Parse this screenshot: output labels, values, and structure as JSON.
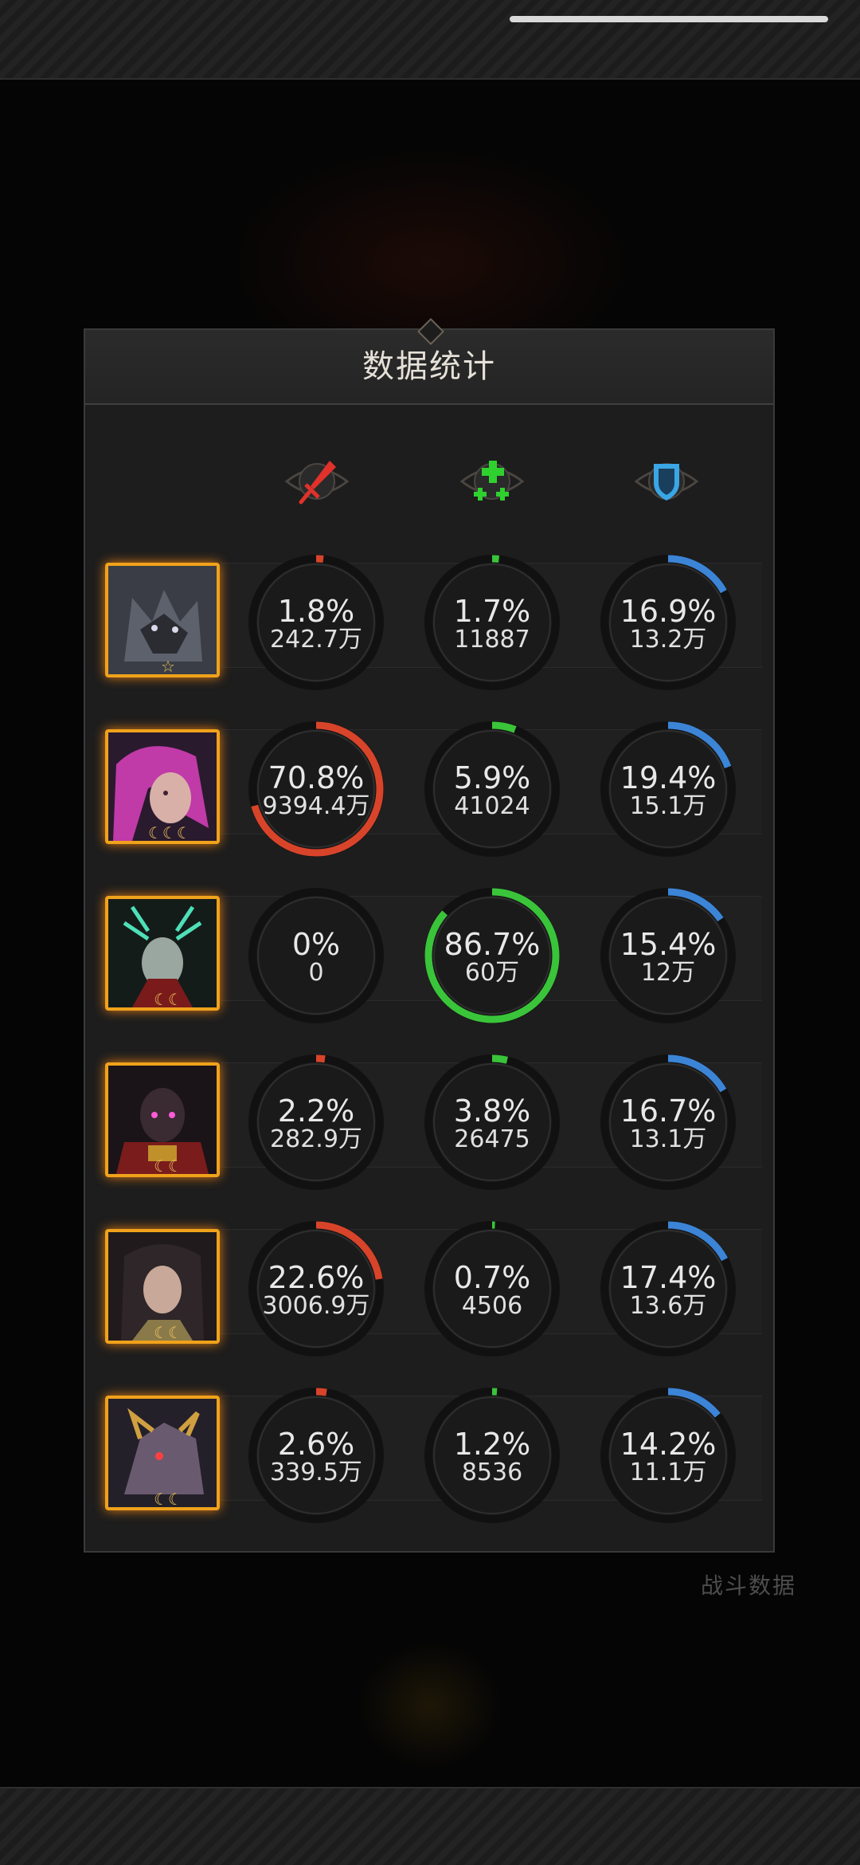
{
  "panel": {
    "title": "数据统计"
  },
  "background": {
    "caption": "战斗数据"
  },
  "columns": [
    {
      "icon": "sword-icon",
      "color": "#e0322a"
    },
    {
      "icon": "heal-cross-icon",
      "color": "#2fd12f"
    },
    {
      "icon": "shield-icon",
      "color": "#3aa6e6"
    }
  ],
  "colors": {
    "damage": "#d8442a",
    "heal": "#3ac43a",
    "tank": "#3c84d6",
    "avatar_border": "#f0a21b"
  },
  "rows": [
    {
      "hero": "wolf",
      "marks": "☆",
      "damage": {
        "pct": "1.8%",
        "amount": "242.7万",
        "fraction": 0.018
      },
      "heal": {
        "pct": "1.7%",
        "amount": "11887",
        "fraction": 0.017
      },
      "tank": {
        "pct": "16.9%",
        "amount": "13.2万",
        "fraction": 0.169
      }
    },
    {
      "hero": "pink-hair-mage",
      "marks": "☾☾☾",
      "damage": {
        "pct": "70.8%",
        "amount": "9394.4万",
        "fraction": 0.708
      },
      "heal": {
        "pct": "5.9%",
        "amount": "41024",
        "fraction": 0.059
      },
      "tank": {
        "pct": "19.4%",
        "amount": "15.1万",
        "fraction": 0.194
      }
    },
    {
      "hero": "antler-druid",
      "marks": "☾☾",
      "damage": {
        "pct": "0%",
        "amount": "0",
        "fraction": 0
      },
      "heal": {
        "pct": "86.7%",
        "amount": "60万",
        "fraction": 0.867
      },
      "tank": {
        "pct": "15.4%",
        "amount": "12万",
        "fraction": 0.154
      }
    },
    {
      "hero": "dark-warrior",
      "marks": "☾☾",
      "damage": {
        "pct": "2.2%",
        "amount": "282.9万",
        "fraction": 0.022
      },
      "heal": {
        "pct": "3.8%",
        "amount": "26475",
        "fraction": 0.038
      },
      "tank": {
        "pct": "16.7%",
        "amount": "13.1万",
        "fraction": 0.167
      }
    },
    {
      "hero": "sorceress",
      "marks": "☾☾",
      "damage": {
        "pct": "22.6%",
        "amount": "3006.9万",
        "fraction": 0.226
      },
      "heal": {
        "pct": "0.7%",
        "amount": "4506",
        "fraction": 0.007
      },
      "tank": {
        "pct": "17.4%",
        "amount": "13.6万",
        "fraction": 0.174
      }
    },
    {
      "hero": "dragon",
      "marks": "☾☾",
      "damage": {
        "pct": "2.6%",
        "amount": "339.5万",
        "fraction": 0.026
      },
      "heal": {
        "pct": "1.2%",
        "amount": "8536",
        "fraction": 0.012
      },
      "tank": {
        "pct": "14.2%",
        "amount": "11.1万",
        "fraction": 0.142
      }
    }
  ]
}
